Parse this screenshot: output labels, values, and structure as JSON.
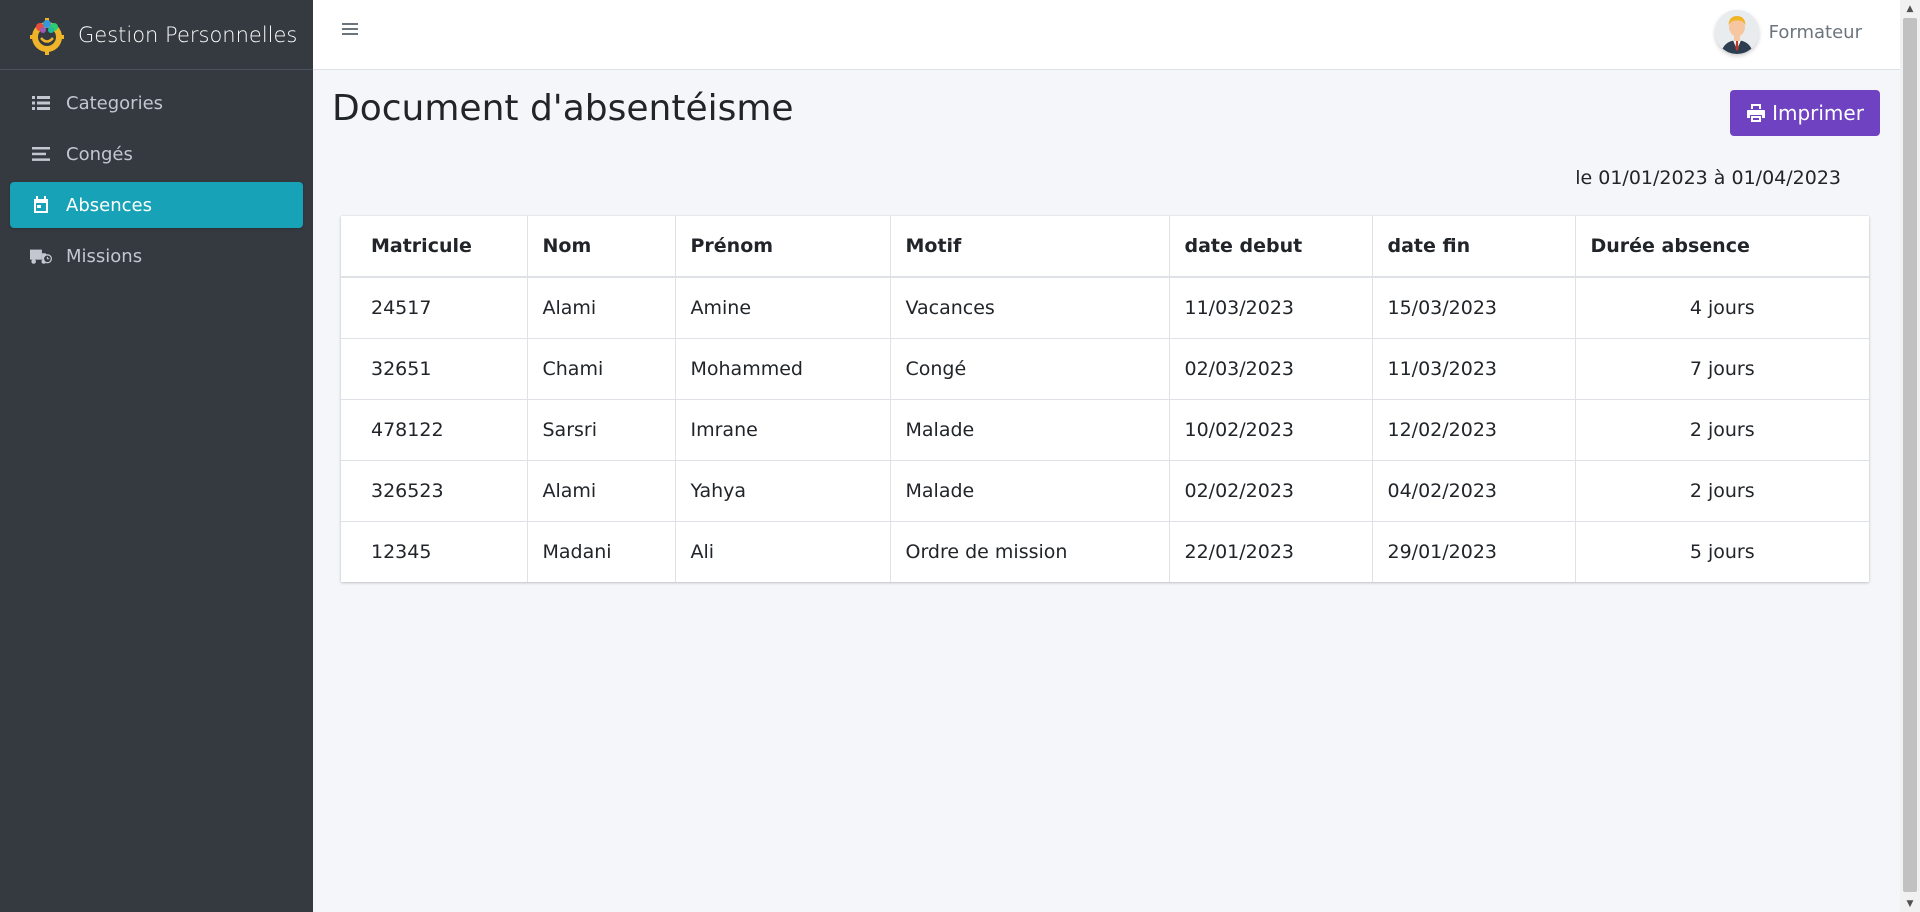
{
  "app": {
    "title": "Gestion Personnelles"
  },
  "sidebar": {
    "items": [
      {
        "label": "Categories",
        "icon": "list-icon",
        "active": false
      },
      {
        "label": "Congés",
        "icon": "lines-icon",
        "active": false
      },
      {
        "label": "Absences",
        "icon": "calendar-icon",
        "active": true
      },
      {
        "label": "Missions",
        "icon": "truck-clock-icon",
        "active": false
      }
    ]
  },
  "topbar": {
    "user_name": "Formateur"
  },
  "page": {
    "title": "Document d'absentéisme",
    "print_label": "Imprimer",
    "period": "le 01/01/2023 à 01/04/2023"
  },
  "table": {
    "headers": [
      "Matricule",
      "Nom",
      "Prénom",
      "Motif",
      "date debut",
      "date fin",
      "Durée absence"
    ],
    "rows": [
      [
        "24517",
        "Alami",
        "Amine",
        "Vacances",
        "11/03/2023",
        "15/03/2023",
        "4 jours"
      ],
      [
        "32651",
        "Chami",
        "Mohammed",
        "Congé",
        "02/03/2023",
        "11/03/2023",
        "7 jours"
      ],
      [
        "478122",
        "Sarsri",
        "Imrane",
        "Malade",
        "10/02/2023",
        "12/02/2023",
        "2 jours"
      ],
      [
        "326523",
        "Alami",
        "Yahya",
        "Malade",
        "02/02/2023",
        "04/02/2023",
        "2 jours"
      ],
      [
        "12345",
        "Madani",
        "Ali",
        "Ordre de mission",
        "22/01/2023",
        "29/01/2023",
        "5 jours"
      ]
    ]
  },
  "colors": {
    "sidebar_bg": "#343a40",
    "active_item": "#17a2b8",
    "print_button": "#6f42c1",
    "content_bg": "#f4f6f9"
  }
}
